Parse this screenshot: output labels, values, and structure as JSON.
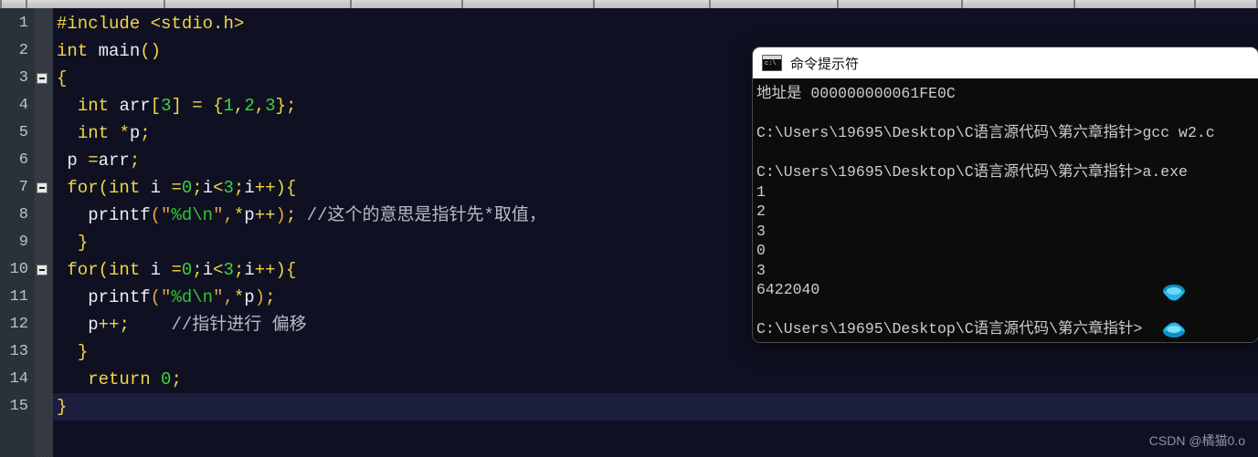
{
  "toolbar": {
    "segment_widths": [
      26,
      152,
      206,
      122,
      144,
      128,
      140,
      136,
      124,
      132,
      67
    ]
  },
  "editor": {
    "line_numbers": [
      "1",
      "2",
      "3",
      "4",
      "5",
      "6",
      "7",
      "8",
      "9",
      "10",
      "11",
      "12",
      "13",
      "14",
      "15"
    ],
    "fold_marker_lines": [
      3,
      7,
      10
    ],
    "current_line": 15,
    "lines": [
      {
        "n": 1,
        "tokens": [
          {
            "t": "#include ",
            "c": "tok-pre"
          },
          {
            "t": "<stdio.h>",
            "c": "tok-pre"
          }
        ]
      },
      {
        "n": 2,
        "tokens": [
          {
            "t": "int",
            "c": "tok-key"
          },
          {
            "t": " ",
            "c": "tok-plain"
          },
          {
            "t": "main",
            "c": "tok-id"
          },
          {
            "t": "()",
            "c": "tok-punct"
          }
        ]
      },
      {
        "n": 3,
        "tokens": [
          {
            "t": "{",
            "c": "tok-punct"
          }
        ]
      },
      {
        "n": 4,
        "tokens": [
          {
            "t": "  ",
            "c": "tok-plain"
          },
          {
            "t": "int",
            "c": "tok-key"
          },
          {
            "t": " ",
            "c": "tok-plain"
          },
          {
            "t": "arr",
            "c": "tok-id"
          },
          {
            "t": "[",
            "c": "tok-punct"
          },
          {
            "t": "3",
            "c": "tok-num"
          },
          {
            "t": "]",
            "c": "tok-punct"
          },
          {
            "t": " ",
            "c": "tok-plain"
          },
          {
            "t": "=",
            "c": "tok-op"
          },
          {
            "t": " ",
            "c": "tok-plain"
          },
          {
            "t": "{",
            "c": "tok-punct"
          },
          {
            "t": "1",
            "c": "tok-num"
          },
          {
            "t": ",",
            "c": "tok-punct"
          },
          {
            "t": "2",
            "c": "tok-num"
          },
          {
            "t": ",",
            "c": "tok-punct"
          },
          {
            "t": "3",
            "c": "tok-num"
          },
          {
            "t": "}",
            "c": "tok-punct"
          },
          {
            "t": ";",
            "c": "tok-punct"
          }
        ]
      },
      {
        "n": 5,
        "tokens": [
          {
            "t": "  ",
            "c": "tok-plain"
          },
          {
            "t": "int",
            "c": "tok-key"
          },
          {
            "t": " ",
            "c": "tok-plain"
          },
          {
            "t": "*",
            "c": "tok-op"
          },
          {
            "t": "p",
            "c": "tok-id"
          },
          {
            "t": ";",
            "c": "tok-punct"
          }
        ]
      },
      {
        "n": 6,
        "tokens": [
          {
            "t": " ",
            "c": "tok-plain"
          },
          {
            "t": "p",
            "c": "tok-id"
          },
          {
            "t": " ",
            "c": "tok-plain"
          },
          {
            "t": "=",
            "c": "tok-op"
          },
          {
            "t": "arr",
            "c": "tok-id"
          },
          {
            "t": ";",
            "c": "tok-punct"
          }
        ]
      },
      {
        "n": 7,
        "tokens": [
          {
            "t": " ",
            "c": "tok-plain"
          },
          {
            "t": "for",
            "c": "tok-key"
          },
          {
            "t": "(",
            "c": "tok-punct"
          },
          {
            "t": "int",
            "c": "tok-key"
          },
          {
            "t": " ",
            "c": "tok-plain"
          },
          {
            "t": "i",
            "c": "tok-id"
          },
          {
            "t": " ",
            "c": "tok-plain"
          },
          {
            "t": "=",
            "c": "tok-op"
          },
          {
            "t": "0",
            "c": "tok-num"
          },
          {
            "t": ";",
            "c": "tok-punct"
          },
          {
            "t": "i",
            "c": "tok-id"
          },
          {
            "t": "<",
            "c": "tok-op"
          },
          {
            "t": "3",
            "c": "tok-num"
          },
          {
            "t": ";",
            "c": "tok-punct"
          },
          {
            "t": "i",
            "c": "tok-id"
          },
          {
            "t": "++",
            "c": "tok-op"
          },
          {
            "t": ")",
            "c": "tok-punct"
          },
          {
            "t": "{",
            "c": "tok-punct"
          }
        ]
      },
      {
        "n": 8,
        "tokens": [
          {
            "t": "   ",
            "c": "tok-plain"
          },
          {
            "t": "printf",
            "c": "tok-id"
          },
          {
            "t": "(",
            "c": "tok-quote"
          },
          {
            "t": "\"",
            "c": "tok-quote"
          },
          {
            "t": "%d\\n",
            "c": "tok-str"
          },
          {
            "t": "\"",
            "c": "tok-quote"
          },
          {
            "t": ",",
            "c": "tok-quote"
          },
          {
            "t": "*",
            "c": "tok-op"
          },
          {
            "t": "p",
            "c": "tok-id"
          },
          {
            "t": "++",
            "c": "tok-op"
          },
          {
            "t": ")",
            "c": "tok-quote"
          },
          {
            "t": ";",
            "c": "tok-punct"
          },
          {
            "t": " ",
            "c": "tok-plain"
          },
          {
            "t": "//这个的意思是指针先*取值，",
            "c": "tok-cmt"
          }
        ]
      },
      {
        "n": 9,
        "tokens": [
          {
            "t": "  ",
            "c": "tok-plain"
          },
          {
            "t": "}",
            "c": "tok-punct"
          }
        ]
      },
      {
        "n": 10,
        "tokens": [
          {
            "t": " ",
            "c": "tok-plain"
          },
          {
            "t": "for",
            "c": "tok-key"
          },
          {
            "t": "(",
            "c": "tok-punct"
          },
          {
            "t": "int",
            "c": "tok-key"
          },
          {
            "t": " ",
            "c": "tok-plain"
          },
          {
            "t": "i",
            "c": "tok-id"
          },
          {
            "t": " ",
            "c": "tok-plain"
          },
          {
            "t": "=",
            "c": "tok-op"
          },
          {
            "t": "0",
            "c": "tok-num"
          },
          {
            "t": ";",
            "c": "tok-punct"
          },
          {
            "t": "i",
            "c": "tok-id"
          },
          {
            "t": "<",
            "c": "tok-op"
          },
          {
            "t": "3",
            "c": "tok-num"
          },
          {
            "t": ";",
            "c": "tok-punct"
          },
          {
            "t": "i",
            "c": "tok-id"
          },
          {
            "t": "++",
            "c": "tok-op"
          },
          {
            "t": ")",
            "c": "tok-punct"
          },
          {
            "t": "{",
            "c": "tok-punct"
          }
        ]
      },
      {
        "n": 11,
        "tokens": [
          {
            "t": "   ",
            "c": "tok-plain"
          },
          {
            "t": "printf",
            "c": "tok-id"
          },
          {
            "t": "(",
            "c": "tok-quote"
          },
          {
            "t": "\"",
            "c": "tok-quote"
          },
          {
            "t": "%d\\n",
            "c": "tok-str"
          },
          {
            "t": "\"",
            "c": "tok-quote"
          },
          {
            "t": ",",
            "c": "tok-quote"
          },
          {
            "t": "*",
            "c": "tok-op"
          },
          {
            "t": "p",
            "c": "tok-id"
          },
          {
            "t": ")",
            "c": "tok-quote"
          },
          {
            "t": ";",
            "c": "tok-punct"
          }
        ]
      },
      {
        "n": 12,
        "tokens": [
          {
            "t": "   ",
            "c": "tok-plain"
          },
          {
            "t": "p",
            "c": "tok-id"
          },
          {
            "t": "++",
            "c": "tok-op"
          },
          {
            "t": ";",
            "c": "tok-punct"
          },
          {
            "t": "    ",
            "c": "tok-plain"
          },
          {
            "t": "//指针进行 偏移",
            "c": "tok-cmt"
          }
        ]
      },
      {
        "n": 13,
        "tokens": [
          {
            "t": "  ",
            "c": "tok-plain"
          },
          {
            "t": "}",
            "c": "tok-punct"
          }
        ]
      },
      {
        "n": 14,
        "tokens": [
          {
            "t": "   ",
            "c": "tok-plain"
          },
          {
            "t": "return",
            "c": "tok-key"
          },
          {
            "t": " ",
            "c": "tok-plain"
          },
          {
            "t": "0",
            "c": "tok-num"
          },
          {
            "t": ";",
            "c": "tok-punct"
          }
        ]
      },
      {
        "n": 15,
        "tokens": [
          {
            "t": "}",
            "c": "tok-punct"
          }
        ]
      }
    ]
  },
  "cmd_window": {
    "title": "命令提示符",
    "icon": "cmd-console-icon",
    "lines": [
      "地址是 000000000061FE0C",
      "",
      "C:\\Users\\19695\\Desktop\\C语言源代码\\第六章指针>gcc w2.c",
      "",
      "C:\\Users\\19695\\Desktop\\C语言源代码\\第六章指针>a.exe",
      "1",
      "2",
      "3",
      "0",
      "3",
      "6422040",
      "",
      "C:\\Users\\19695\\Desktop\\C语言源代码\\第六章指针>"
    ]
  },
  "cursor": {
    "type": "busy-hourglass-cursor",
    "color": "#1ea7e1"
  },
  "watermark": {
    "text": "CSDN @橘猫0.o"
  },
  "colors": {
    "editor_bg": "#0f1123",
    "gutter_bg": "#2b3138",
    "current_line_bg": "#1b1f3d",
    "keyword": "#f2d544",
    "string": "#2fc72f",
    "number": "#3ad63a",
    "comment": "#b4bcc6",
    "console_bg": "#0c0c0c",
    "console_fg": "#ccccd4"
  }
}
